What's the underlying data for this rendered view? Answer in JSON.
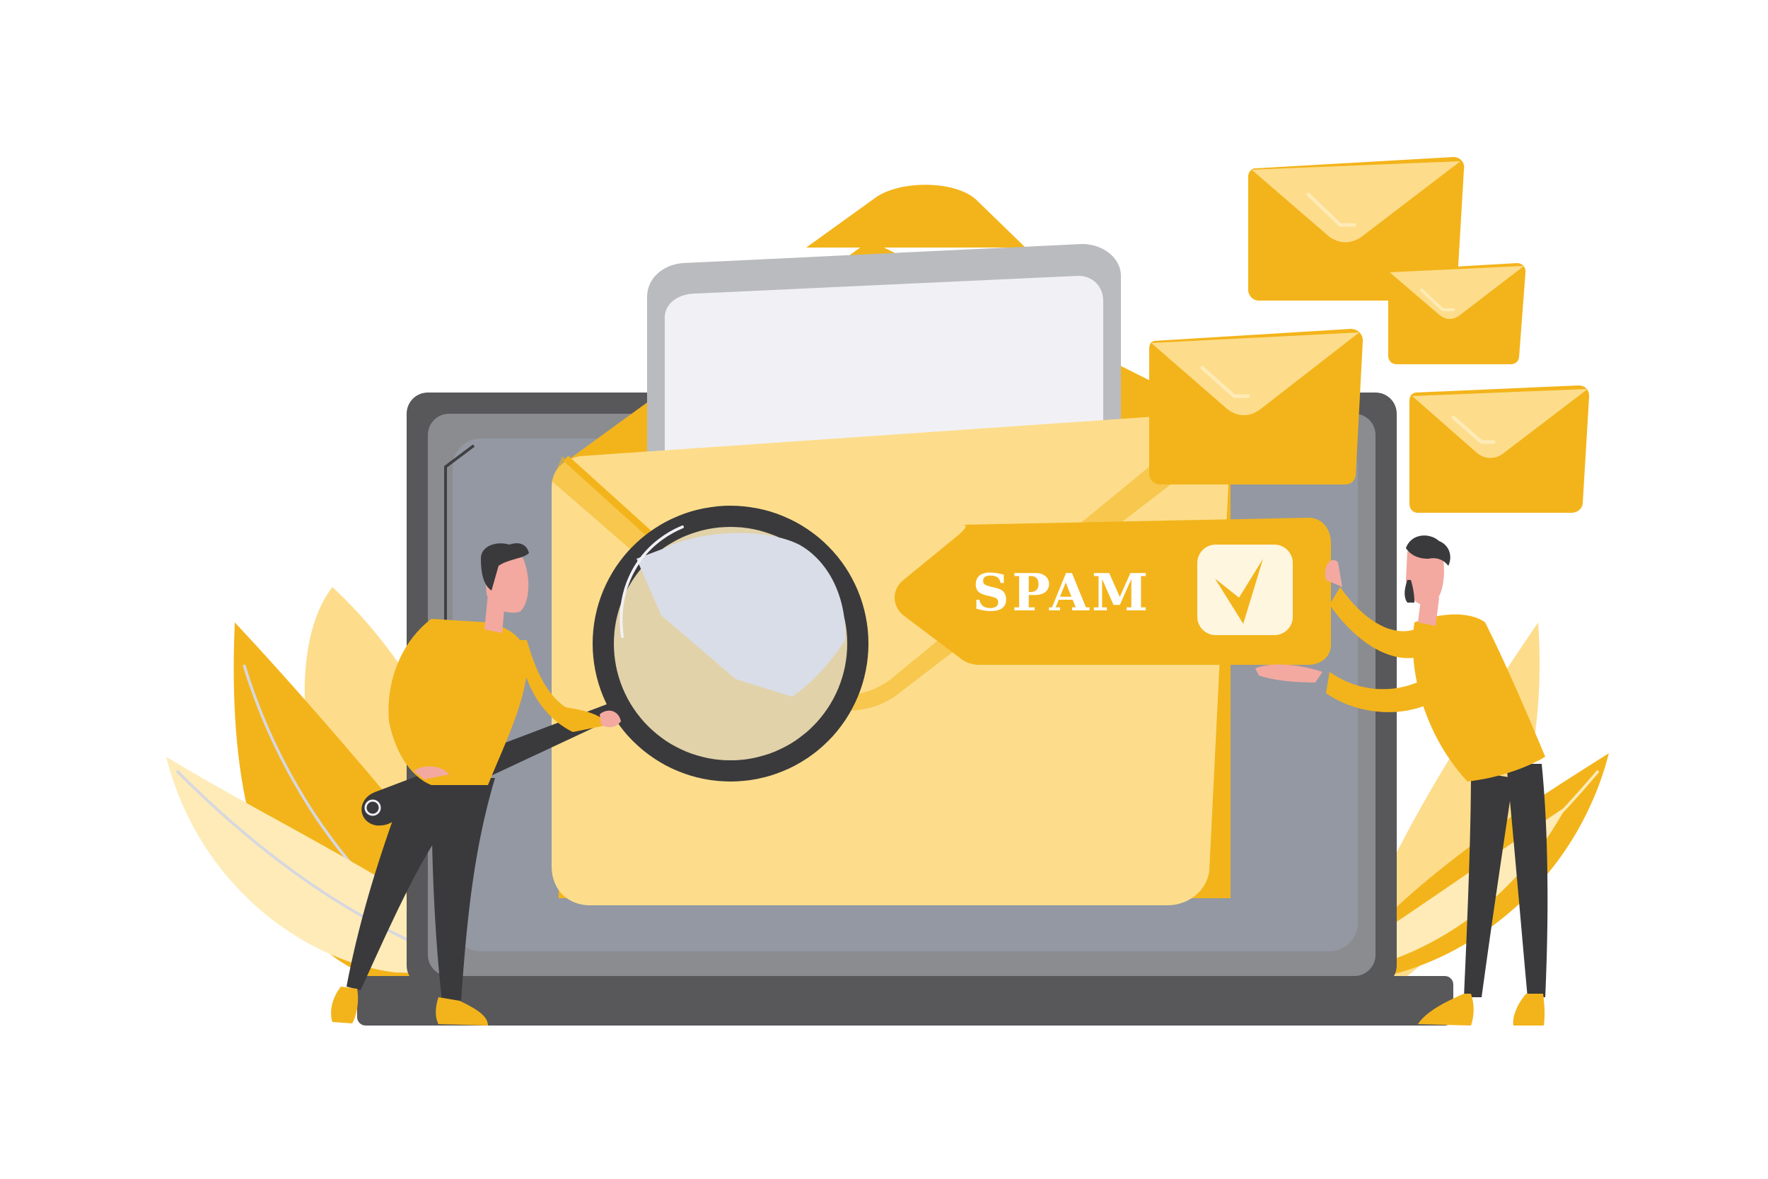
{
  "spam_tag": {
    "label": "SPAM",
    "checked": true,
    "check_icon": "checkbox-checked-icon"
  },
  "colors": {
    "accent_yellow": "#F3B41B",
    "light_yellow": "#FDDD8C",
    "pale_yellow": "#FEEBB7",
    "laptop_dark": "#58585B",
    "laptop_screen": "#9398A3",
    "paper": "#F1F1F5",
    "paper_frame": "#BABBBE",
    "skin": "#F3A9A0",
    "pants": "#3A3A3C",
    "background": "#FFFFFF"
  },
  "icons": [
    "envelope-icon",
    "magnifying-glass-icon",
    "laptop-icon",
    "leaf-icon",
    "person-icon",
    "checkbox-checked-icon"
  ]
}
